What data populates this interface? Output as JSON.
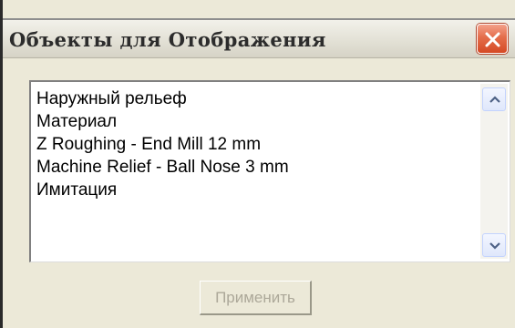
{
  "window": {
    "title": "Объекты для Отображения"
  },
  "colors": {
    "dialog_bg": "#ece9d8",
    "close_button": "#d54a25",
    "disabled_text": "#aca899"
  },
  "list": {
    "items": [
      "Наружный рельеф",
      "Материал",
      "Z Roughing - End Mill 12 mm",
      "Machine Relief - Ball Nose 3 mm",
      "Имитация"
    ]
  },
  "icons": {
    "close": "close-icon",
    "scroll_up": "chevron-up-icon",
    "scroll_down": "chevron-down-icon"
  },
  "buttons": {
    "apply_label": "Применить",
    "apply_state": "disabled"
  }
}
